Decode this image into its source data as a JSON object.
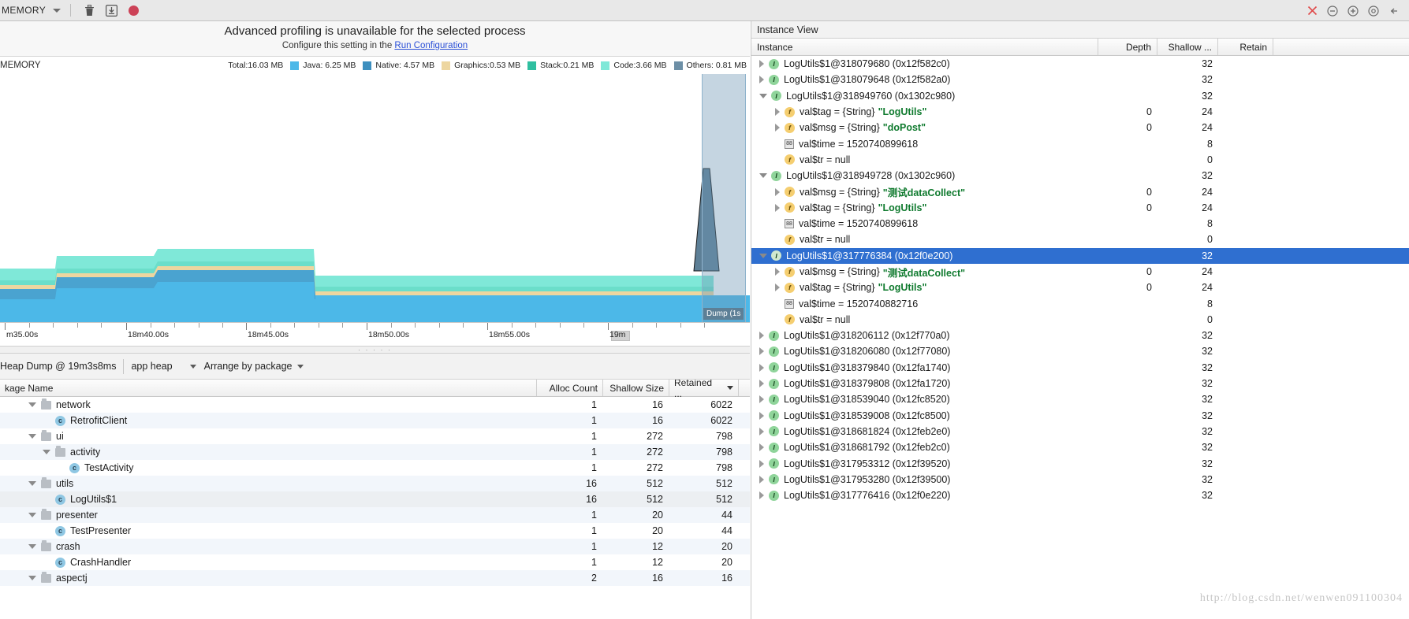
{
  "toolbar": {
    "session_label": "MEMORY",
    "caret_icon": "chevron-down-icon",
    "trash_icon": "trash-icon",
    "export_icon": "export-heap-dump-icon",
    "record_icon": "record-allocations-icon",
    "close_icon": "close-icon",
    "minimize_icon": "minimize-icon",
    "maximize_icon": "maximize-icon",
    "settings_icon": "gear-icon",
    "hide_icon": "hide-icon"
  },
  "banner": {
    "title": "Advanced profiling is unavailable for the selected process",
    "sub_prefix": "Configure this setting in the ",
    "link": "Run Configuration"
  },
  "chart_header": {
    "name": "MEMORY"
  },
  "chart_data": {
    "type": "area",
    "title": "MEMORY",
    "stacked": true,
    "xlabel": "",
    "ylabel": "MB",
    "legend_position": "top-right",
    "total_label": "Total:16.03 MB",
    "total_mb": 16.03,
    "x_ticks": [
      "m35.00s",
      "18m40.00s",
      "18m45.00s",
      "18m50.00s",
      "18m55.00s",
      "19m"
    ],
    "series": [
      {
        "name": "Java",
        "label": "Java:  6.25 MB",
        "value_mb": 6.25,
        "color": "#4cb8e8"
      },
      {
        "name": "Native",
        "label": "Native: 4.57 MB",
        "value_mb": 4.57,
        "color": "#3d8fbf"
      },
      {
        "name": "Graphics",
        "label": "Graphics:0.53 MB",
        "value_mb": 0.53,
        "color": "#edd6a0"
      },
      {
        "name": "Stack",
        "label": "Stack:0.21 MB",
        "value_mb": 0.21,
        "color": "#2fbfa0"
      },
      {
        "name": "Code",
        "label": "Code:3.66 MB",
        "value_mb": 3.66,
        "color": "#7fe8d8"
      },
      {
        "name": "Others",
        "label": "Others: 0.81 MB",
        "value_mb": 0.81,
        "color": "#6d8fa6"
      }
    ],
    "dump_marker": {
      "label": "Dump (1s",
      "x_time": "19m3s8ms"
    }
  },
  "heap_toolbar": {
    "dump_title": "Heap Dump @ 19m3s8ms",
    "heap_select": "app heap",
    "arrange_select": "Arrange by package"
  },
  "heap_table": {
    "columns": [
      "kage Name",
      "Alloc Count",
      "Shallow Size",
      "Retained ..."
    ],
    "sorted_column": "Retained ...",
    "rows": [
      {
        "indent": 1,
        "twisty": "open",
        "icon": "folder",
        "label": "network",
        "alloc": "1",
        "shallow": "16",
        "retained": "6022",
        "selected": false
      },
      {
        "indent": 2,
        "twisty": "none",
        "icon": "class",
        "label": "RetrofitClient",
        "alloc": "1",
        "shallow": "16",
        "retained": "6022",
        "selected": false
      },
      {
        "indent": 1,
        "twisty": "open",
        "icon": "folder",
        "label": "ui",
        "alloc": "1",
        "shallow": "272",
        "retained": "798",
        "selected": false
      },
      {
        "indent": 2,
        "twisty": "open",
        "icon": "folder",
        "label": "activity",
        "alloc": "1",
        "shallow": "272",
        "retained": "798",
        "selected": false
      },
      {
        "indent": 3,
        "twisty": "none",
        "icon": "class",
        "label": "TestActivity",
        "alloc": "1",
        "shallow": "272",
        "retained": "798",
        "selected": false
      },
      {
        "indent": 1,
        "twisty": "open",
        "icon": "folder",
        "label": "utils",
        "alloc": "16",
        "shallow": "512",
        "retained": "512",
        "selected": false
      },
      {
        "indent": 2,
        "twisty": "none",
        "icon": "class",
        "label": "LogUtils$1",
        "alloc": "16",
        "shallow": "512",
        "retained": "512",
        "selected": true
      },
      {
        "indent": 1,
        "twisty": "open",
        "icon": "folder",
        "label": "presenter",
        "alloc": "1",
        "shallow": "20",
        "retained": "44",
        "selected": false
      },
      {
        "indent": 2,
        "twisty": "none",
        "icon": "class",
        "label": "TestPresenter",
        "alloc": "1",
        "shallow": "20",
        "retained": "44",
        "selected": false
      },
      {
        "indent": 1,
        "twisty": "open",
        "icon": "folder",
        "label": "crash",
        "alloc": "1",
        "shallow": "12",
        "retained": "20",
        "selected": false
      },
      {
        "indent": 2,
        "twisty": "none",
        "icon": "class",
        "label": "CrashHandler",
        "alloc": "1",
        "shallow": "12",
        "retained": "20",
        "selected": false
      },
      {
        "indent": 1,
        "twisty": "open",
        "icon": "folder",
        "label": "aspectj",
        "alloc": "2",
        "shallow": "16",
        "retained": "16",
        "selected": false
      }
    ]
  },
  "instance_view": {
    "title": "Instance View",
    "columns": [
      "Instance",
      "Depth",
      "Shallow ...",
      "Retain"
    ],
    "rows": [
      {
        "indent": 0,
        "twisty": "closed",
        "icon": "instance",
        "label": "LogUtils$1@318079680 (0x12f582c0)",
        "depth": "",
        "shallow": "32",
        "selected": false
      },
      {
        "indent": 0,
        "twisty": "closed",
        "icon": "instance",
        "label": "LogUtils$1@318079648 (0x12f582a0)",
        "depth": "",
        "shallow": "32",
        "selected": false
      },
      {
        "indent": 0,
        "twisty": "open",
        "icon": "instance",
        "label": "LogUtils$1@318949760 (0x1302c980)",
        "depth": "",
        "shallow": "32",
        "selected": false
      },
      {
        "indent": 1,
        "twisty": "closed",
        "icon": "field",
        "label": "val$tag = {String} ",
        "value": "\"LogUtils\"",
        "depth": "0",
        "shallow": "24",
        "selected": false
      },
      {
        "indent": 1,
        "twisty": "closed",
        "icon": "field",
        "label": "val$msg = {String} ",
        "value": "\"doPost\"",
        "depth": "0",
        "shallow": "24",
        "selected": false
      },
      {
        "indent": 1,
        "twisty": "none",
        "icon": "number",
        "label": "val$time = 1520740899618",
        "depth": "",
        "shallow": "8",
        "selected": false
      },
      {
        "indent": 1,
        "twisty": "none",
        "icon": "field",
        "label": "val$tr = null",
        "depth": "",
        "shallow": "0",
        "selected": false
      },
      {
        "indent": 0,
        "twisty": "open",
        "icon": "instance",
        "label": "LogUtils$1@318949728 (0x1302c960)",
        "depth": "",
        "shallow": "32",
        "selected": false
      },
      {
        "indent": 1,
        "twisty": "closed",
        "icon": "field",
        "label": "val$msg = {String} ",
        "value": "\"测试dataCollect\"",
        "depth": "0",
        "shallow": "24",
        "selected": false
      },
      {
        "indent": 1,
        "twisty": "closed",
        "icon": "field",
        "label": "val$tag = {String} ",
        "value": "\"LogUtils\"",
        "depth": "0",
        "shallow": "24",
        "selected": false
      },
      {
        "indent": 1,
        "twisty": "none",
        "icon": "number",
        "label": "val$time = 1520740899618",
        "depth": "",
        "shallow": "8",
        "selected": false
      },
      {
        "indent": 1,
        "twisty": "none",
        "icon": "field",
        "label": "val$tr = null",
        "depth": "",
        "shallow": "0",
        "selected": false
      },
      {
        "indent": 0,
        "twisty": "open",
        "icon": "instance",
        "label": "LogUtils$1@317776384 (0x12f0e200)",
        "depth": "",
        "shallow": "32",
        "selected": true
      },
      {
        "indent": 1,
        "twisty": "closed",
        "icon": "field",
        "label": "val$msg = {String} ",
        "value": "\"测试dataCollect\"",
        "depth": "0",
        "shallow": "24",
        "selected": false
      },
      {
        "indent": 1,
        "twisty": "closed",
        "icon": "field",
        "label": "val$tag = {String} ",
        "value": "\"LogUtils\"",
        "depth": "0",
        "shallow": "24",
        "selected": false
      },
      {
        "indent": 1,
        "twisty": "none",
        "icon": "number",
        "label": "val$time = 1520740882716",
        "depth": "",
        "shallow": "8",
        "selected": false
      },
      {
        "indent": 1,
        "twisty": "none",
        "icon": "field",
        "label": "val$tr = null",
        "depth": "",
        "shallow": "0",
        "selected": false
      },
      {
        "indent": 0,
        "twisty": "closed",
        "icon": "instance",
        "label": "LogUtils$1@318206112 (0x12f770a0)",
        "depth": "",
        "shallow": "32",
        "selected": false
      },
      {
        "indent": 0,
        "twisty": "closed",
        "icon": "instance",
        "label": "LogUtils$1@318206080 (0x12f77080)",
        "depth": "",
        "shallow": "32",
        "selected": false
      },
      {
        "indent": 0,
        "twisty": "closed",
        "icon": "instance",
        "label": "LogUtils$1@318379840 (0x12fa1740)",
        "depth": "",
        "shallow": "32",
        "selected": false
      },
      {
        "indent": 0,
        "twisty": "closed",
        "icon": "instance",
        "label": "LogUtils$1@318379808 (0x12fa1720)",
        "depth": "",
        "shallow": "32",
        "selected": false
      },
      {
        "indent": 0,
        "twisty": "closed",
        "icon": "instance",
        "label": "LogUtils$1@318539040 (0x12fc8520)",
        "depth": "",
        "shallow": "32",
        "selected": false
      },
      {
        "indent": 0,
        "twisty": "closed",
        "icon": "instance",
        "label": "LogUtils$1@318539008 (0x12fc8500)",
        "depth": "",
        "shallow": "32",
        "selected": false
      },
      {
        "indent": 0,
        "twisty": "closed",
        "icon": "instance",
        "label": "LogUtils$1@318681824 (0x12feb2e0)",
        "depth": "",
        "shallow": "32",
        "selected": false
      },
      {
        "indent": 0,
        "twisty": "closed",
        "icon": "instance",
        "label": "LogUtils$1@318681792 (0x12feb2c0)",
        "depth": "",
        "shallow": "32",
        "selected": false
      },
      {
        "indent": 0,
        "twisty": "closed",
        "icon": "instance",
        "label": "LogUtils$1@317953312 (0x12f39520)",
        "depth": "",
        "shallow": "32",
        "selected": false
      },
      {
        "indent": 0,
        "twisty": "closed",
        "icon": "instance",
        "label": "LogUtils$1@317953280 (0x12f39500)",
        "depth": "",
        "shallow": "32",
        "selected": false
      },
      {
        "indent": 0,
        "twisty": "closed",
        "icon": "instance",
        "label": "LogUtils$1@317776416 (0x12f0e220)",
        "depth": "",
        "shallow": "32",
        "selected": false
      }
    ],
    "watermark": "http://blog.csdn.net/wenwen091100304"
  }
}
